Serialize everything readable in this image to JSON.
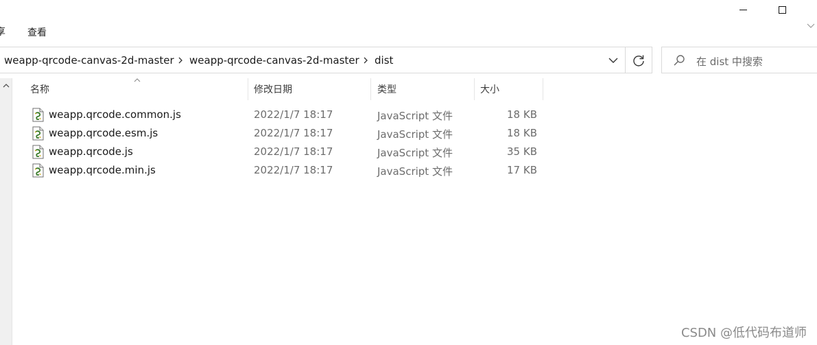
{
  "window": {
    "minimize_icon": "minimize-icon",
    "maximize_icon": "maximize-icon"
  },
  "ribbon": {
    "partial_tab": "享",
    "view_tab": "查看"
  },
  "address_bar": {
    "breadcrumbs": [
      "weapp-qrcode-canvas-2d-master",
      "weapp-qrcode-canvas-2d-master",
      "dist"
    ]
  },
  "search": {
    "placeholder": "在 dist 中搜索"
  },
  "columns": {
    "name": "名称",
    "date": "修改日期",
    "type": "类型",
    "size": "大小"
  },
  "files": [
    {
      "name": "weapp.qrcode.common.js",
      "date": "2022/1/7 18:17",
      "type": "JavaScript 文件",
      "size": "18 KB"
    },
    {
      "name": "weapp.qrcode.esm.js",
      "date": "2022/1/7 18:17",
      "type": "JavaScript 文件",
      "size": "18 KB"
    },
    {
      "name": "weapp.qrcode.js",
      "date": "2022/1/7 18:17",
      "type": "JavaScript 文件",
      "size": "35 KB"
    },
    {
      "name": "weapp.qrcode.min.js",
      "date": "2022/1/7 18:17",
      "type": "JavaScript 文件",
      "size": "17 KB"
    }
  ],
  "watermark": "CSDN @低代码布道师"
}
